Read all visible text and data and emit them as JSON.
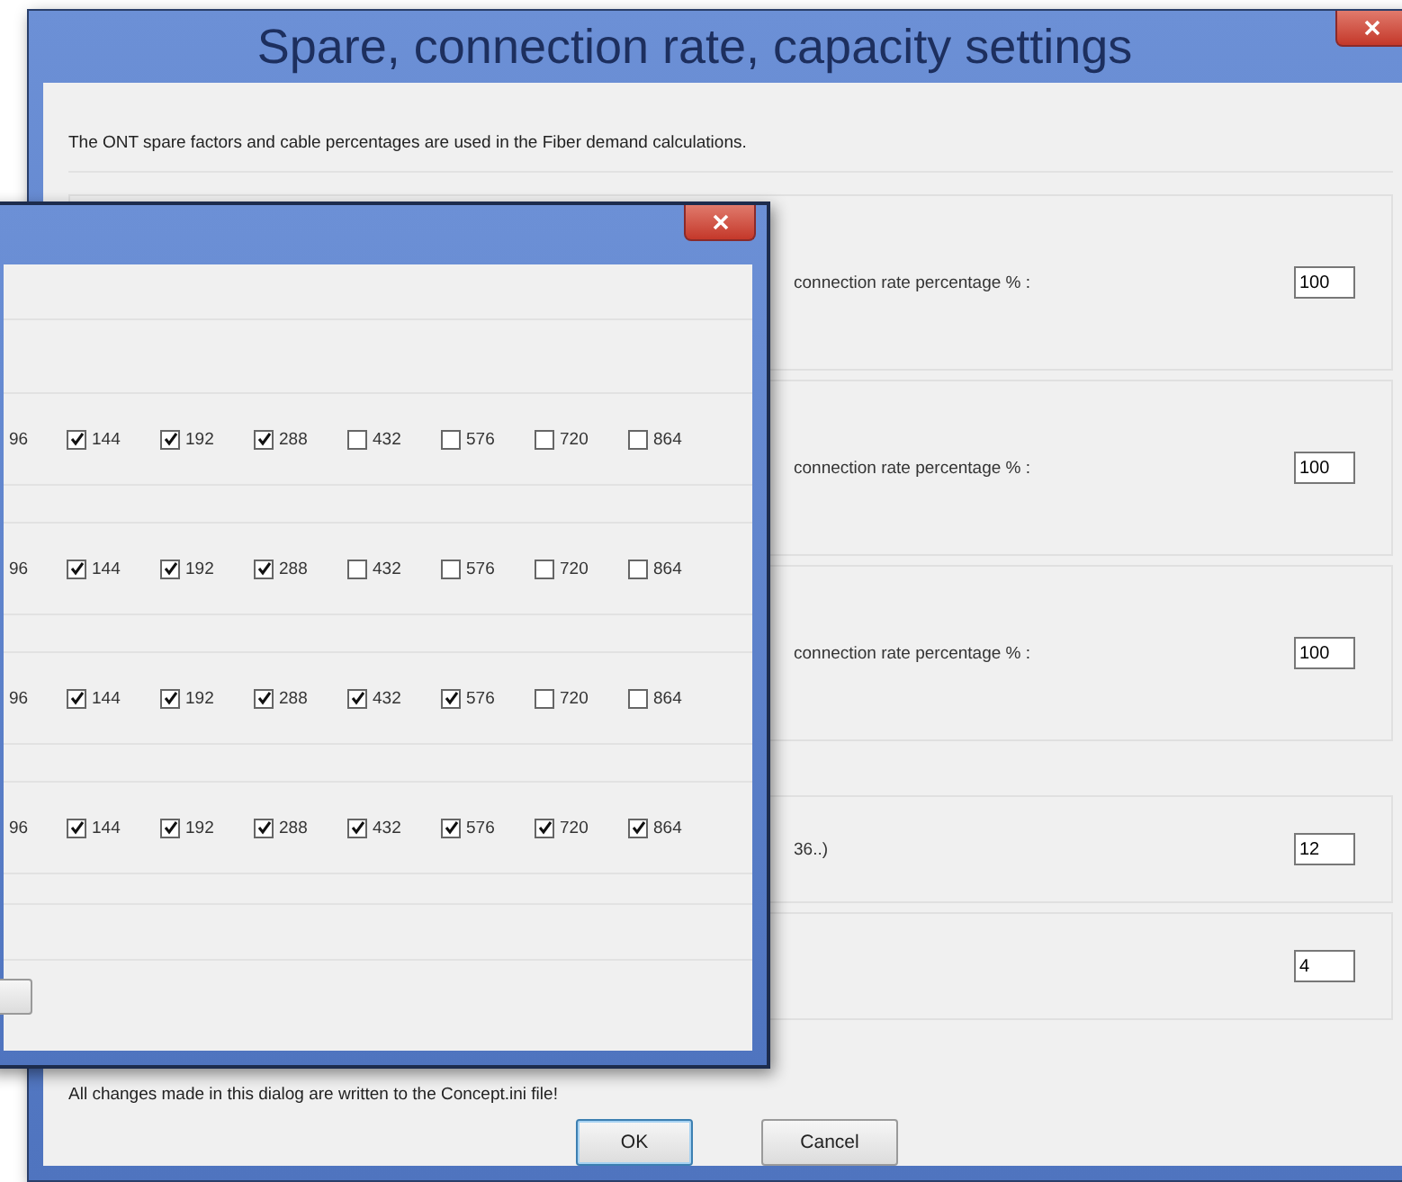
{
  "back_window": {
    "title": "Spare, connection rate, capacity settings",
    "intro": "The ONT spare factors and cable percentages are used in the Fiber demand calculations.",
    "rows": [
      {
        "label": "connection rate percentage % :",
        "value": "100"
      },
      {
        "label": "connection rate percentage % :",
        "value": "100"
      },
      {
        "label": "connection rate percentage % :",
        "value": "100"
      },
      {
        "label": "36..)",
        "value": "12"
      },
      {
        "value": "4"
      }
    ],
    "footer": "All changes made in this dialog are written to the Concept.ini file!",
    "buttons": [
      {
        "label": "OK",
        "default": true
      },
      {
        "label": "Cancel",
        "default": false
      }
    ]
  },
  "front_window": {
    "rows": [
      {
        "cut_label": "96",
        "options": [
          {
            "label": "144",
            "checked": true
          },
          {
            "label": "192",
            "checked": true
          },
          {
            "label": "288",
            "checked": true
          },
          {
            "label": "432",
            "checked": false
          },
          {
            "label": "576",
            "checked": false
          },
          {
            "label": "720",
            "checked": false
          },
          {
            "label": "864",
            "checked": false
          }
        ]
      },
      {
        "cut_label": "96",
        "options": [
          {
            "label": "144",
            "checked": true
          },
          {
            "label": "192",
            "checked": true
          },
          {
            "label": "288",
            "checked": true
          },
          {
            "label": "432",
            "checked": false
          },
          {
            "label": "576",
            "checked": false
          },
          {
            "label": "720",
            "checked": false
          },
          {
            "label": "864",
            "checked": false
          }
        ]
      },
      {
        "cut_label": "96",
        "options": [
          {
            "label": "144",
            "checked": true
          },
          {
            "label": "192",
            "checked": true
          },
          {
            "label": "288",
            "checked": true
          },
          {
            "label": "432",
            "checked": true
          },
          {
            "label": "576",
            "checked": true
          },
          {
            "label": "720",
            "checked": false
          },
          {
            "label": "864",
            "checked": false
          }
        ]
      },
      {
        "cut_label": "96",
        "options": [
          {
            "label": "144",
            "checked": true
          },
          {
            "label": "192",
            "checked": true
          },
          {
            "label": "288",
            "checked": true
          },
          {
            "label": "432",
            "checked": true
          },
          {
            "label": "576",
            "checked": true
          },
          {
            "label": "720",
            "checked": true
          },
          {
            "label": "864",
            "checked": true
          }
        ]
      }
    ]
  }
}
